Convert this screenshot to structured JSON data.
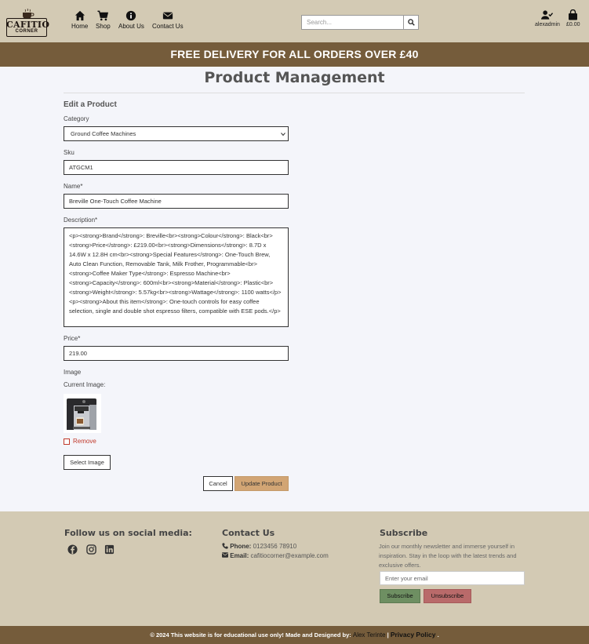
{
  "brand": {
    "name": "CAFITIO",
    "sub": "CORNER"
  },
  "nav": {
    "home": "Home",
    "shop": "Shop",
    "about": "About Us",
    "contact": "Contact Us"
  },
  "search": {
    "placeholder": "Search..."
  },
  "account": {
    "username": "alexadmin",
    "basket_total": "£0.00"
  },
  "banner": "FREE DELIVERY FOR ALL ORDERS OVER £40",
  "page": {
    "title": "Product Management",
    "subtitle": "Edit a Product"
  },
  "form": {
    "category_label": "Category",
    "category_value": "Ground Coffee Machines",
    "sku_label": "Sku",
    "sku_value": "ATGCM1",
    "name_label": "Name*",
    "name_value": "Breville One-Touch Coffee Machine",
    "description_label": "Description*",
    "description_value": "<p><strong>Brand</strong>: Breville<br><strong>Colour</strong>: Black<br><strong>Price</strong>: £219.00<br><strong>Dimensions</strong>: 8.7D x 14.6W x 12.8H cm<br><strong>Special Features</strong>: One-Touch Brew, Auto Clean Function, Removable Tank, Milk Frother, Programmable<br><strong>Coffee Maker Type</strong>: Espresso Machine<br><strong>Capacity</strong>: 600ml<br><strong>Material</strong>: Plastic<br><strong>Weight</strong>: 5.57kg<br><strong>Wattage</strong>: 1100 watts</p><p><strong>About this item</strong>: One-touch controls for easy coffee selection, single and double shot espresso filters, compatible with ESE pods.</p>",
    "price_label": "Price*",
    "price_value": "219.00",
    "image_label": "Image",
    "current_image_label": "Current Image:",
    "remove_label": "Remove",
    "select_image_label": "Select Image",
    "cancel_label": "Cancel",
    "update_label": "Update Product"
  },
  "footer": {
    "social_title": "Follow us on social media:",
    "contact_title": "Contact Us",
    "phone_label": "Phone:",
    "phone_value": "0123456 78910",
    "email_label": "Email:",
    "email_value": "cafitiocorner@example.com",
    "subscribe_title": "Subscribe",
    "subscribe_text": "Join our monthly newsletter and immerse yourself in inspiration. Stay in the loop with the latest trends and exclusive offers.",
    "email_placeholder": "Enter your email",
    "subscribe_btn": "Subscribe",
    "unsubscribe_btn": "Unsubscribe",
    "copyright": "© 2024 This website is for educational use only! Made and Designed by:",
    "author": "Alex Terinte",
    "separator": "|",
    "privacy": "Privacy Policy",
    "end": "."
  },
  "colors": {
    "header_bg": "#d3cab4",
    "banner_bg": "#755c3b",
    "update_btn": "#d2a574",
    "subscribe_btn": "#6e8f62",
    "unsubscribe_btn": "#b96a6a",
    "remove_red": "#c0392b"
  },
  "icons": {
    "home": "home-icon",
    "shop": "cart-icon",
    "about": "info-icon",
    "contact": "envelope-icon",
    "search": "search-icon",
    "account": "user-check-icon",
    "basket": "shopping-bag-icon",
    "facebook": "facebook-icon",
    "instagram": "instagram-icon",
    "linkedin": "linkedin-icon",
    "phone": "phone-icon",
    "email": "envelope-icon"
  }
}
